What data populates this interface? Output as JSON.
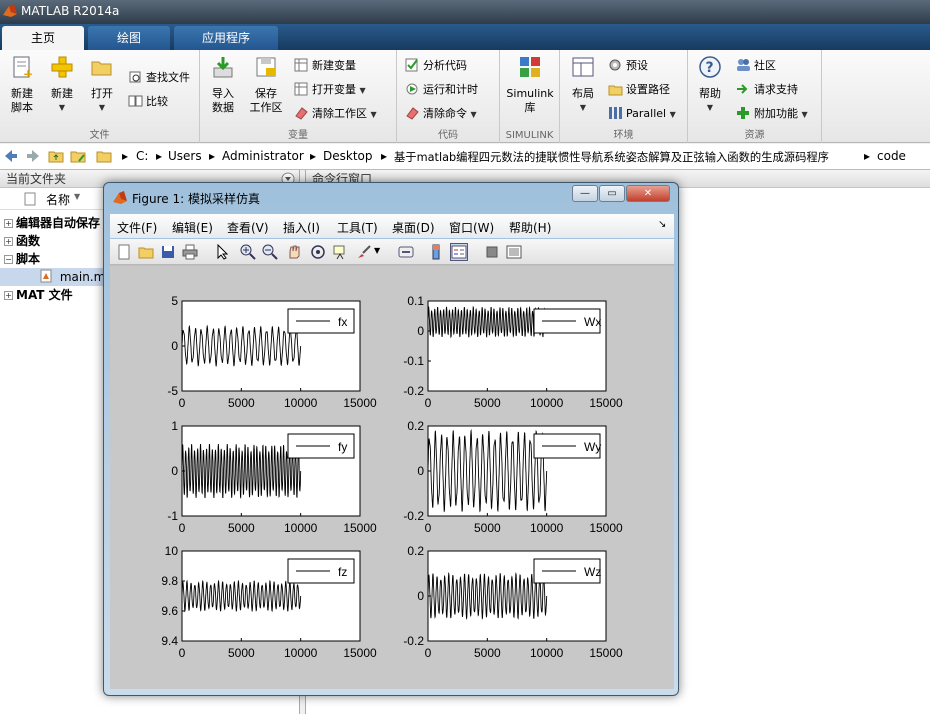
{
  "app": {
    "title": "MATLAB R2014a"
  },
  "tabs": [
    {
      "label": "主页"
    },
    {
      "label": "绘图"
    },
    {
      "label": "应用程序"
    }
  ],
  "ribbon": {
    "new_script": "新建\n脚本",
    "new": "新建",
    "open": "打开",
    "find_files": "查找文件",
    "compare": "比较",
    "import": "导入\n数据",
    "save_ws": "保存\n工作区",
    "new_var": "新建变量",
    "open_var": "打开变量",
    "clear_ws": "清除工作区",
    "analyze": "分析代码",
    "run_time": "运行和计时",
    "clear_cmd": "清除命令",
    "simulink": "Simulink\n库",
    "layout": "布局",
    "prefs": "预设",
    "set_path": "设置路径",
    "parallel": "Parallel",
    "help": "帮助",
    "community": "社区",
    "request_support": "请求支持",
    "addons": "附加功能",
    "groups": {
      "file": "文件",
      "variable": "变量",
      "code": "代码",
      "simulink": "SIMULINK",
      "env": "环境",
      "resources": "资源"
    }
  },
  "path": [
    "C:",
    "Users",
    "Administrator",
    "Desktop",
    "基于matlab编程四元数法的捷联惯性导航系统姿态解算及正弦输入函数的生成源码程序",
    "code"
  ],
  "left_panel": {
    "title": "当前文件夹",
    "col_name": "名称",
    "items": [
      {
        "label": "编辑器自动保存"
      },
      {
        "label": "函数"
      },
      {
        "label": "脚本"
      },
      {
        "label": "main.m"
      },
      {
        "label": "MAT 文件"
      }
    ]
  },
  "right_panel": {
    "title": "命令行窗口"
  },
  "figure": {
    "title": "Figure 1: 模拟采样仿真",
    "menu": [
      "文件(F)",
      "编辑(E)",
      "查看(V)",
      "插入(I)",
      "工具(T)",
      "桌面(D)",
      "窗口(W)",
      "帮助(H)"
    ],
    "controls": {
      "minimize": "—",
      "restore": "▭",
      "close": "✕"
    }
  },
  "chart_data": [
    {
      "type": "line",
      "legend": "fx",
      "xlim": [
        0,
        15000
      ],
      "ylim": [
        -5,
        5
      ],
      "xticks": [
        "0",
        "5000",
        "10000",
        "15000"
      ],
      "yticks": [
        "5",
        "0",
        "-5"
      ],
      "x_end": 10000,
      "amplitude": 2.2,
      "offset": 0,
      "cycles": 20
    },
    {
      "type": "line",
      "legend": "Wx",
      "xlim": [
        0,
        15000
      ],
      "ylim": [
        -0.2,
        0.1
      ],
      "xticks": [
        "0",
        "5000",
        "10000",
        "15000"
      ],
      "yticks": [
        "0.1",
        "0",
        "-0.1",
        "-0.2"
      ],
      "x_end": 10000,
      "amplitude": 0.05,
      "offset": 0.03,
      "cycles": 40
    },
    {
      "type": "line",
      "legend": "fy",
      "xlim": [
        0,
        15000
      ],
      "ylim": [
        -1,
        1
      ],
      "xticks": [
        "0",
        "5000",
        "10000",
        "15000"
      ],
      "yticks": [
        "1",
        "0",
        "-1"
      ],
      "x_end": 10000,
      "amplitude": 0.6,
      "offset": 0,
      "cycles": 40
    },
    {
      "type": "line",
      "legend": "Wy",
      "xlim": [
        0,
        15000
      ],
      "ylim": [
        -0.2,
        0.2
      ],
      "xticks": [
        "0",
        "5000",
        "10000",
        "15000"
      ],
      "yticks": [
        "0.2",
        "0",
        "-0.2"
      ],
      "x_end": 10000,
      "amplitude": 0.18,
      "offset": 0,
      "cycles": 20
    },
    {
      "type": "line",
      "legend": "fz",
      "xlim": [
        0,
        15000
      ],
      "ylim": [
        9.4,
        10
      ],
      "xticks": [
        "0",
        "5000",
        "10000",
        "15000"
      ],
      "yticks": [
        "10",
        "9.8",
        "9.6",
        "9.4"
      ],
      "x_end": 10000,
      "amplitude": 0.1,
      "offset": 9.7,
      "cycles": 30
    },
    {
      "type": "line",
      "legend": "Wz",
      "xlim": [
        0,
        15000
      ],
      "ylim": [
        -0.2,
        0.2
      ],
      "xticks": [
        "0",
        "5000",
        "10000",
        "15000"
      ],
      "yticks": [
        "0.2",
        "0",
        "-0.2"
      ],
      "x_end": 10000,
      "amplitude": 0.1,
      "offset": 0,
      "cycles": 30
    }
  ]
}
